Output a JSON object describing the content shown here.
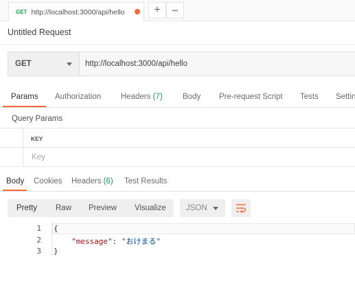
{
  "tab": {
    "method": "GET",
    "url": "http://localhost:3000/api/hello",
    "plus": "+",
    "more": "•••"
  },
  "request": {
    "name": "Untitled Request",
    "method": "GET",
    "url": "http://localhost:3000/api/hello"
  },
  "request_tabs": {
    "params": "Params",
    "authorization": "Authorization",
    "headers": "Headers",
    "headers_count": "(7)",
    "body": "Body",
    "prerequest": "Pre-request Script",
    "tests": "Tests",
    "settings": "Settin"
  },
  "query_params": {
    "title": "Query Params",
    "key_header": "KEY",
    "key_placeholder": "Key"
  },
  "response_tabs": {
    "body": "Body",
    "cookies": "Cookies",
    "headers": "Headers",
    "headers_count": "(6)",
    "test_results": "Test Results"
  },
  "response_toolbar": {
    "pretty": "Pretty",
    "raw": "Raw",
    "preview": "Preview",
    "visualize": "Visualize",
    "format": "JSON"
  },
  "response_body": {
    "line_numbers": [
      "1",
      "2",
      "3"
    ],
    "open_brace": "{",
    "key": "\"message\"",
    "colon": ": ",
    "value": "\"おけまる\"",
    "close_brace": "}"
  },
  "colors": {
    "accent": "#f26b3a",
    "count_green": "#0f9d58",
    "method_green": "#1f9d55"
  }
}
